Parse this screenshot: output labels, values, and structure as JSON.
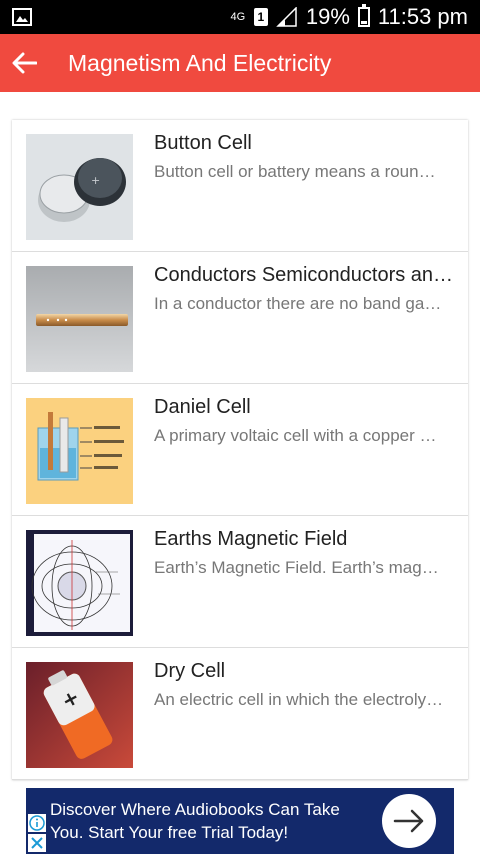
{
  "status_bar": {
    "network": "4G",
    "sim": "1",
    "battery": "19%",
    "time": "11:53 pm"
  },
  "app_bar": {
    "title": "Magnetism And Electricity"
  },
  "items": [
    {
      "title": "Button Cell",
      "description": "Button cell or battery means a round, small single cell"
    },
    {
      "title": "Conductors Semiconductors and Insulators",
      "description": "In a conductor there are no band gaps between the valence"
    },
    {
      "title": "Daniel Cell",
      "description": "A primary voltaic cell with a copper anode and a zinc cathode"
    },
    {
      "title": "Earths Magnetic Field",
      "description": "Earth’s Magnetic Field. Earth’s magnetic field"
    },
    {
      "title": "Dry Cell",
      "description": "An electric cell in which the electrolyte exists in the form of a paste"
    }
  ],
  "ad": {
    "text": "Discover Where Audiobooks Can Take You. Start Your free Trial Today!"
  },
  "icons": {
    "back": "back-arrow-icon",
    "ad_action": "arrow-right-icon",
    "ad_info": "info-icon",
    "ad_close": "close-icon"
  },
  "colors": {
    "app_bar": "#f04a3f",
    "ad_background": "#13296b",
    "status_bar": "#000000"
  }
}
